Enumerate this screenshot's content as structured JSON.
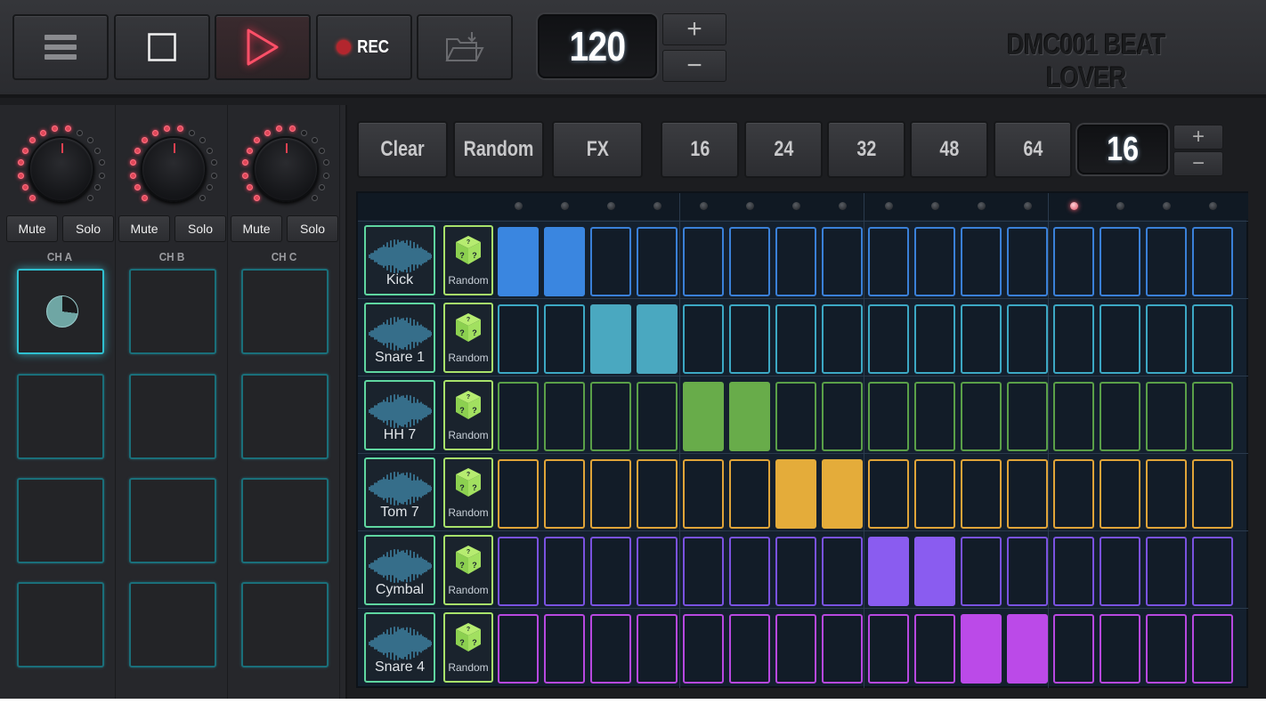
{
  "app": {
    "title": "DMC001 BEAT LOVER"
  },
  "toolbar": {
    "menu_icon": "hamburger-menu-icon",
    "stop_icon": "stop-icon",
    "play_icon": "play-icon",
    "rec_label": "REC",
    "open_icon": "folder-open-icon",
    "bpm": "120",
    "plus": "+",
    "minus": "−"
  },
  "channels": [
    {
      "label": "CH A",
      "mute": "Mute",
      "solo": "Solo",
      "active_pad": 0
    },
    {
      "label": "CH B",
      "mute": "Mute",
      "solo": "Solo"
    },
    {
      "label": "CH C",
      "mute": "Mute",
      "solo": "Solo"
    }
  ],
  "controls": {
    "clear": "Clear",
    "random": "Random",
    "fx": "FX",
    "step_options": [
      "16",
      "24",
      "32",
      "48",
      "64"
    ],
    "steps": "16",
    "plus": "+",
    "minus": "−"
  },
  "sequencer": {
    "playhead_step": 12,
    "tracks": [
      {
        "name": "Kick",
        "random_label": "Random",
        "color": "#3a80d8",
        "fill": "#3a86e0",
        "on": [
          0,
          1
        ]
      },
      {
        "name": "Snare 1",
        "random_label": "Random",
        "color": "#3ca8c4",
        "fill": "#4aa8c0",
        "on": [
          2,
          3
        ]
      },
      {
        "name": "HH 7",
        "random_label": "Random",
        "color": "#5aa048",
        "fill": "#68ac4a",
        "on": [
          4,
          5
        ]
      },
      {
        "name": "Tom 7",
        "random_label": "Random",
        "color": "#e0a438",
        "fill": "#e4ac3a",
        "on": [
          6,
          7
        ]
      },
      {
        "name": "Cymbal",
        "random_label": "Random",
        "color": "#7a52e0",
        "fill": "#8a5cf0",
        "on": [
          8,
          9
        ]
      },
      {
        "name": "Snare 4",
        "random_label": "Random",
        "color": "#b848e0",
        "fill": "#bb4ae8",
        "on": [
          10,
          11
        ]
      }
    ]
  }
}
